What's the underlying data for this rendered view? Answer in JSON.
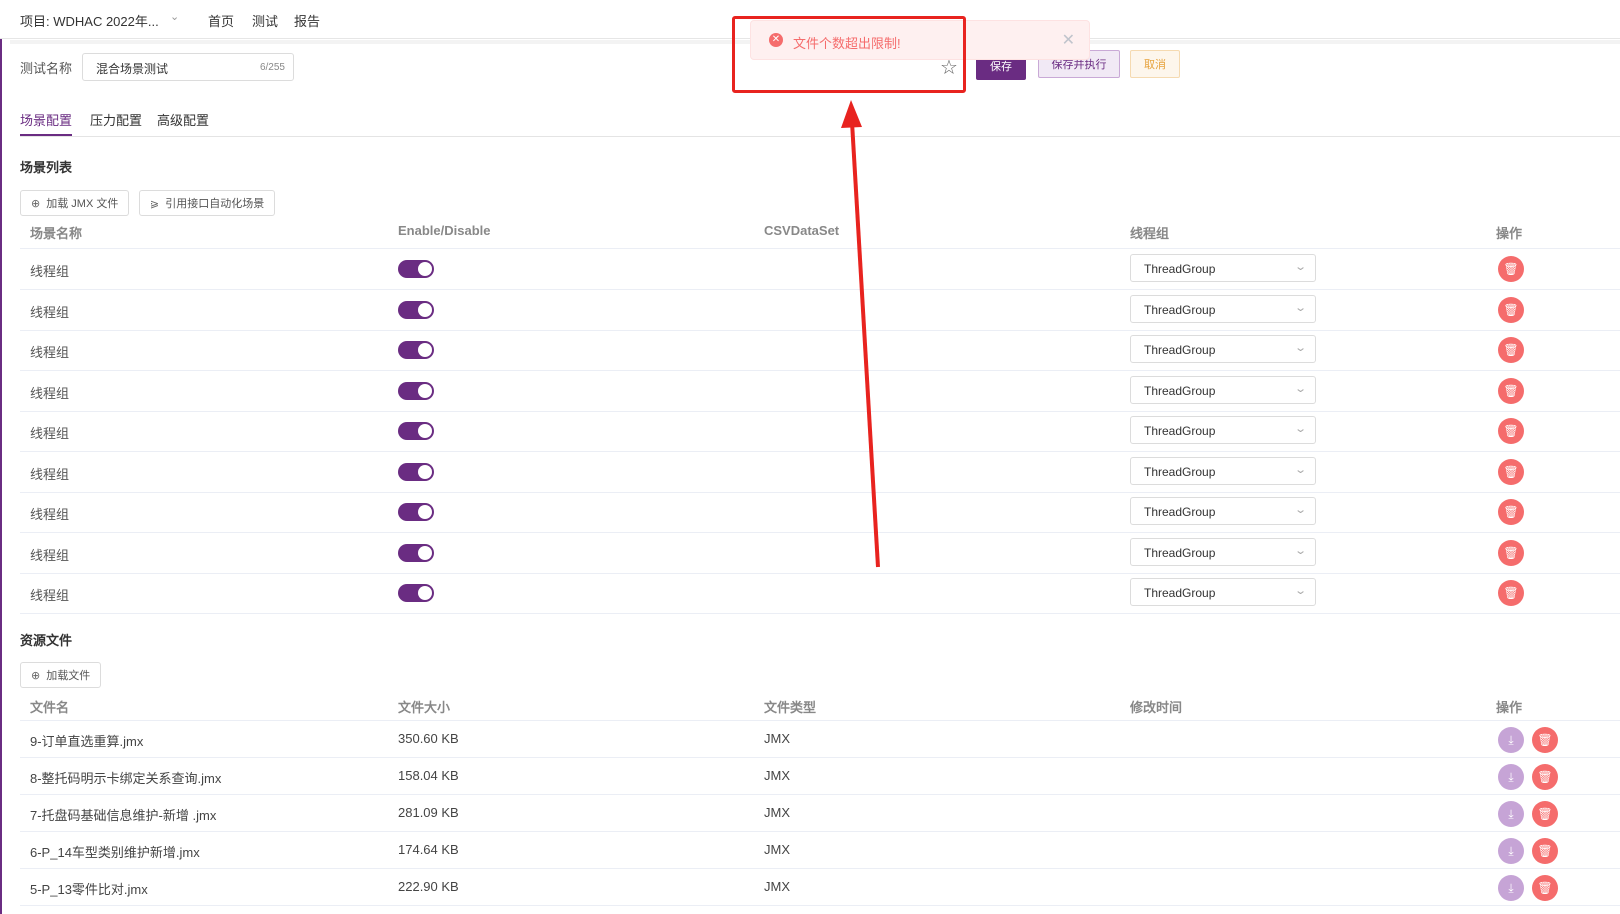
{
  "nav": {
    "project": "项目: WDHAC 2022年...",
    "links": [
      "首页",
      "测试",
      "报告"
    ]
  },
  "test": {
    "name_label": "测试名称",
    "name_value": "混合场景测试",
    "name_count": "6/255"
  },
  "actions": {
    "save": "保存",
    "save_run": "保存并执行",
    "cancel": "取消"
  },
  "tabs": [
    "场景配置",
    "压力配置",
    "高级配置"
  ],
  "scenes": {
    "title": "场景列表",
    "load_jmx": "加载 JMX 文件",
    "reference": "引用接口自动化场景",
    "columns": [
      "场景名称",
      "Enable/Disable",
      "CSVDataSet",
      "线程组",
      "操作"
    ],
    "rows": [
      {
        "name": "线程组",
        "enabled": true,
        "thread": "ThreadGroup"
      },
      {
        "name": "线程组",
        "enabled": true,
        "thread": "ThreadGroup"
      },
      {
        "name": "线程组",
        "enabled": true,
        "thread": "ThreadGroup"
      },
      {
        "name": "线程组",
        "enabled": true,
        "thread": "ThreadGroup"
      },
      {
        "name": "线程组",
        "enabled": true,
        "thread": "ThreadGroup"
      },
      {
        "name": "线程组",
        "enabled": true,
        "thread": "ThreadGroup"
      },
      {
        "name": "线程组",
        "enabled": true,
        "thread": "ThreadGroup"
      },
      {
        "name": "线程组",
        "enabled": true,
        "thread": "ThreadGroup"
      },
      {
        "name": "线程组",
        "enabled": true,
        "thread": "ThreadGroup"
      }
    ]
  },
  "resources": {
    "title": "资源文件",
    "load_file": "加载文件",
    "columns": [
      "文件名",
      "文件大小",
      "文件类型",
      "修改时间",
      "操作"
    ],
    "rows": [
      {
        "name": "9-订单直选重算.jmx",
        "size": "350.60 KB",
        "type": "JMX"
      },
      {
        "name": "8-整托码明示卡绑定关系查询.jmx",
        "size": "158.04 KB",
        "type": "JMX"
      },
      {
        "name": "7-托盘码基础信息维护-新增 .jmx",
        "size": "281.09 KB",
        "type": "JMX"
      },
      {
        "name": "6-P_14车型类别维护新增.jmx",
        "size": "174.64 KB",
        "type": "JMX"
      },
      {
        "name": "5-P_13零件比对.jmx",
        "size": "222.90 KB",
        "type": "JMX"
      }
    ]
  },
  "toast": {
    "message": "文件个数超出限制!"
  },
  "colors": {
    "primary": "#6a2c82",
    "danger": "#f56c6c",
    "annotation": "#e8231f"
  }
}
